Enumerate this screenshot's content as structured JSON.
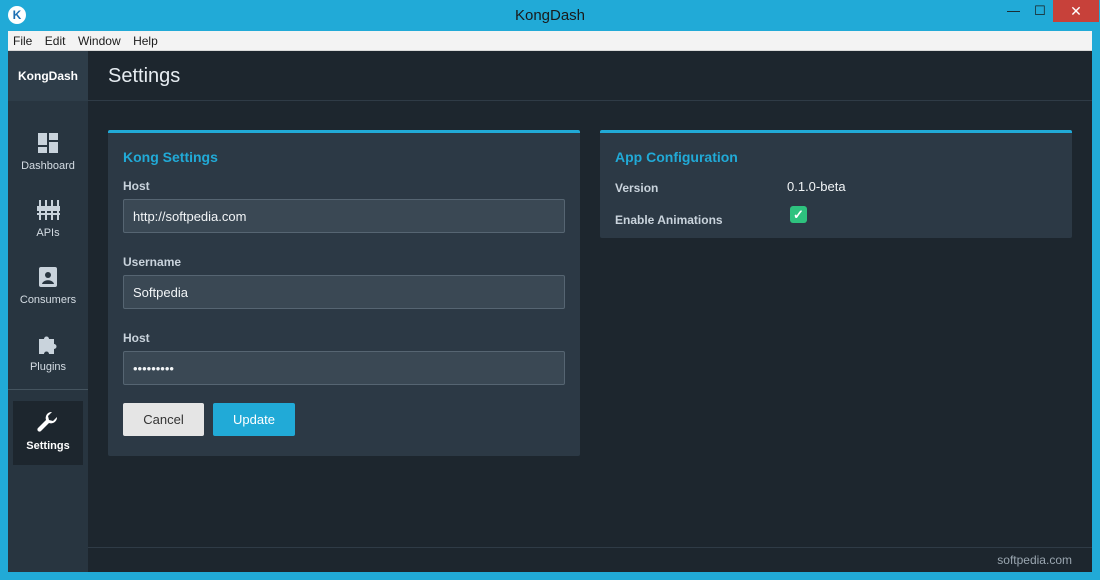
{
  "window": {
    "title": "KongDash",
    "app_icon": "K",
    "minimize_glyph": "—",
    "maximize_glyph": "☐",
    "close_glyph": "✕"
  },
  "menu": [
    {
      "label": "File"
    },
    {
      "label": "Edit"
    },
    {
      "label": "Window"
    },
    {
      "label": "Help"
    }
  ],
  "sidebar": {
    "brand": "KongDash",
    "items": [
      {
        "label": "Dashboard",
        "icon": "dashboard-icon"
      },
      {
        "label": "APIs",
        "icon": "sliders-icon"
      },
      {
        "label": "Consumers",
        "icon": "contact-card-icon"
      },
      {
        "label": "Plugins",
        "icon": "puzzle-icon"
      },
      {
        "label": "Settings",
        "icon": "wrench-icon",
        "active": true
      }
    ]
  },
  "page": {
    "title": "Settings"
  },
  "kong_settings": {
    "title": "Kong Settings",
    "host_label": "Host",
    "host_value": "http://softpedia.com",
    "username_label": "Username",
    "username_value": "Softpedia",
    "password_label": "Host",
    "password_value": "•••••••••",
    "cancel_label": "Cancel",
    "update_label": "Update"
  },
  "app_configuration": {
    "title": "App Configuration",
    "version_label": "Version",
    "version_value": "0.1.0-beta",
    "animations_label": "Enable Animations",
    "animations_enabled": true,
    "check_glyph": "✓"
  },
  "footer": {
    "watermark": "softpedia.com"
  },
  "colors": {
    "accent": "#21aad7",
    "success": "#2ec27e",
    "background": "#1d262e",
    "panel": "#2c3945"
  }
}
